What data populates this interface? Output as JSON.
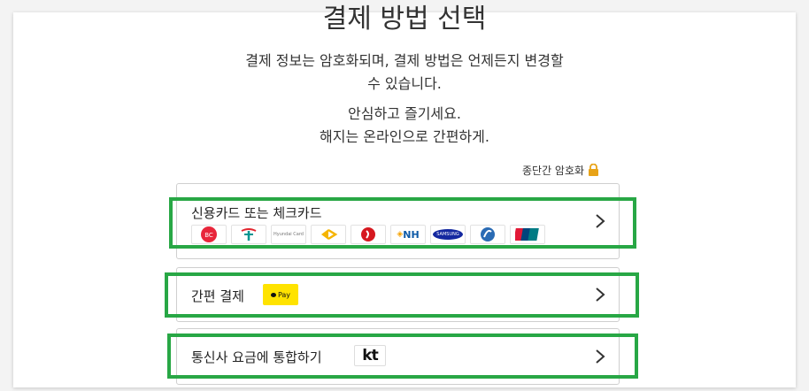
{
  "header": {
    "title": "결제 방법 선택",
    "subtitle_line1": "결제 정보는 암호화되며, 결제 방법은 언제든지 변경할",
    "subtitle_line2": "수 있습니다.",
    "tagline_line1": "안심하고 즐기세요.",
    "tagline_line2": "해지는 온라인으로 간편하게."
  },
  "security": {
    "label": "종단간 암호화",
    "icon": "lock-icon",
    "icon_color": "#e8a317"
  },
  "options": [
    {
      "label": "신용카드 또는 체크카드",
      "logos": [
        "BC",
        "Hana",
        "Hyundai Card",
        "KB",
        "Lotte",
        "NH",
        "SAMSUNG",
        "Shinhan",
        "UnionPay"
      ]
    },
    {
      "label": "간편 결제",
      "badge": "Pay",
      "badge_color": "#ffe300"
    },
    {
      "label": "통신사 요금에 통합하기",
      "badge": "kt"
    }
  ],
  "highlight_color": "#28a745"
}
